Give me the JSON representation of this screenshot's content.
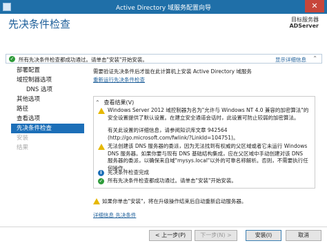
{
  "window": {
    "title": "Active Directory 域服务配置向导",
    "close_glyph": "✕"
  },
  "header": {
    "page_title": "先决条件检查",
    "target_label": "目标服务器",
    "target_server": "ADServer"
  },
  "banner": {
    "text": "所有先决条件检查都成功通过。请单击\"安装\"开始安装。",
    "link": "显示详细信息",
    "chevron": "⌃"
  },
  "nav": {
    "items": [
      {
        "label": "部署配置"
      },
      {
        "label": "域控制器选项"
      },
      {
        "label": "DNS 选项"
      },
      {
        "label": "其他选项"
      },
      {
        "label": "路径"
      },
      {
        "label": "查看选项"
      },
      {
        "label": "先决条件检查"
      },
      {
        "label": "安装"
      },
      {
        "label": "结果"
      }
    ]
  },
  "content": {
    "intro": "需要验证先决条件后才能在此计算机上安装 Active Directory 域服务",
    "rerun_link": "重新运行先决条件检查"
  },
  "results": {
    "header": "查看结果(V)",
    "caret": "⌃",
    "messages": [
      {
        "type": "warning",
        "text": "Windows Server 2012 域控制器为名为\"允许与 Windows NT 4.0 兼容的加密算法\"的安全设置提供了默认设置。在建立安全通道会话时，此设置可防止较弱的加密算法。"
      },
      {
        "type": "none",
        "text": "有关此设置的详细信息，请参阅知识库文章 942564 (http://go.microsoft.com/fwlink/?LinkId=104751)。"
      },
      {
        "type": "warning",
        "text": "无法创建该 DNS 服务器的委派，因为无法找到有权威的父区域或者它未运行 Windows DNS 服务器。如果你要与现有 DNS 基础结构集成，应在父区域中手动创建对该 DNS 服务器的委派，以确保来自域\"mysys.local\"以外的可靠名称解析。否则，不需要执行任何操作。"
      },
      {
        "type": "info",
        "text": "先决条件检查完成"
      },
      {
        "type": "ok",
        "text": "所有先决条件检查都成功通过。请单击\"安装\"开始安装。"
      }
    ]
  },
  "footer": {
    "warning": "如果你单击\"安装\"，将在升级操作结束后自动重新启动服务器。",
    "more_link": "详细信息 先决条件"
  },
  "buttons": {
    "prev": "< 上一步(P)",
    "next": "下一步(N) >",
    "install": "安装(I)",
    "cancel": "取消"
  },
  "colors": {
    "accent": "#1c6fb8",
    "titlebar": "#1f6fa8",
    "ok": "#2e9b3a",
    "warning": "#e6b800"
  }
}
